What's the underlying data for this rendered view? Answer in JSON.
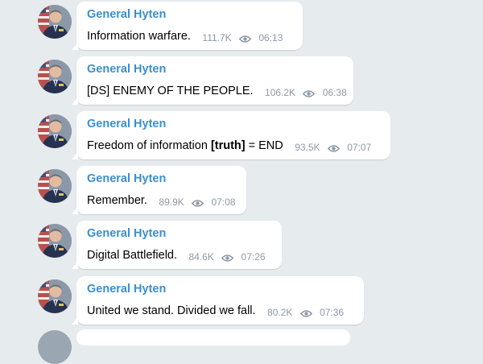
{
  "colors": {
    "background": "#e6ebee",
    "bubble": "#ffffff",
    "sender": "#3a8fcf",
    "meta": "#8d99a6"
  },
  "messages": [
    {
      "sender": "General Hyten",
      "text": "Information warfare.",
      "views": "111.7K",
      "time": "06:13"
    },
    {
      "sender": "General Hyten",
      "text": "[DS] ENEMY OF THE PEOPLE.",
      "views": "106.2K",
      "time": "06:38"
    },
    {
      "sender": "General Hyten",
      "text_before": "Freedom of information ",
      "text_bold": "[truth]",
      "text_after": " = END",
      "views": "93.5K",
      "time": "07:07"
    },
    {
      "sender": "General Hyten",
      "text": "Remember.",
      "views": "89.9K",
      "time": "07:08"
    },
    {
      "sender": "General Hyten",
      "text": "Digital Battlefield.",
      "views": "84.6K",
      "time": "07:26"
    },
    {
      "sender": "General Hyten",
      "text": "United we stand. Divided we fall.",
      "views": "80.2K",
      "time": "07:36"
    }
  ]
}
